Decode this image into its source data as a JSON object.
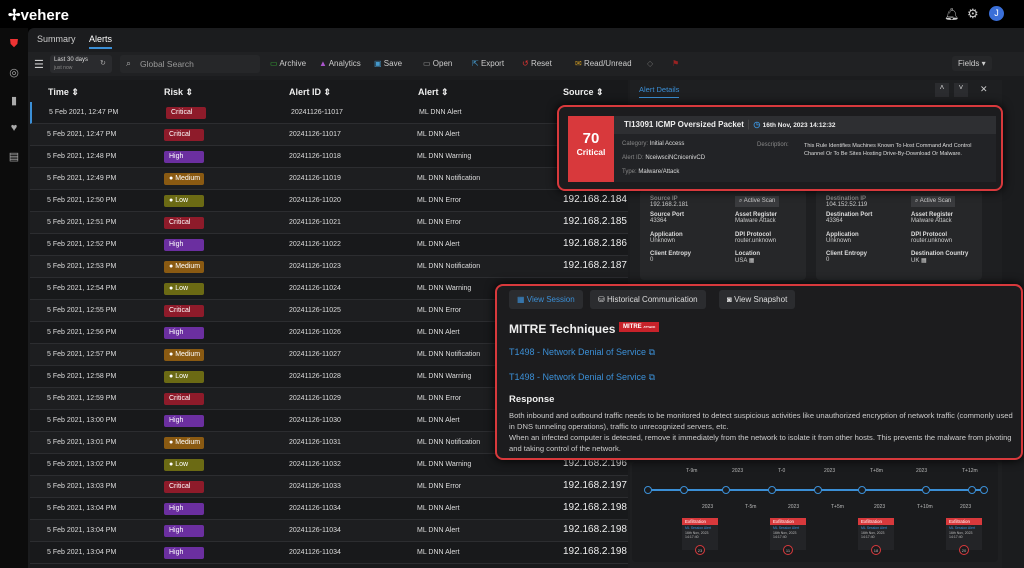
{
  "app": {
    "logo": "vehere"
  },
  "tabs": [
    "Summary",
    "Alerts"
  ],
  "toolbar": {
    "date_range": "Last 30 days",
    "date_sub": "just now",
    "search_placeholder": "Global Search",
    "archive": "Archive",
    "analytics": "Analytics",
    "save": "Save",
    "open": "Open",
    "export": "Export",
    "reset": "Reset",
    "read_unread": "Read/Unread",
    "fields": "Fields"
  },
  "table": {
    "headers": [
      "Time",
      "Risk",
      "Alert ID",
      "Alert",
      "Source"
    ],
    "rows": [
      [
        "5 Feb 2021, 12:47 PM",
        "Critical",
        "20241126-11017",
        "ML DNN Alert",
        ""
      ],
      [
        "5 Feb 2021, 12:47 PM",
        "Critical",
        "20241126-11017",
        "ML DNN Alert",
        ""
      ],
      [
        "5 Feb 2021, 12:48 PM",
        "High",
        "20241126-11018",
        "ML DNN Warning",
        ""
      ],
      [
        "5 Feb 2021, 12:49 PM",
        "Medium",
        "20241126-11019",
        "ML DNN Notification",
        ""
      ],
      [
        "5 Feb 2021, 12:50 PM",
        "Low",
        "20241126-11020",
        "ML DNN Error",
        "192.168.2.184"
      ],
      [
        "5 Feb 2021, 12:51 PM",
        "Critical",
        "20241126-11021",
        "ML DNN Error",
        "192.168.2.185"
      ],
      [
        "5 Feb 2021, 12:52 PM",
        "High",
        "20241126-11022",
        "ML DNN Alert",
        "192.168.2.186"
      ],
      [
        "5 Feb 2021, 12:53 PM",
        "Medium",
        "20241126-11023",
        "ML DNN Notification",
        "192.168.2.187"
      ],
      [
        "5 Feb 2021, 12:54 PM",
        "Low",
        "20241126-11024",
        "ML DNN Warning",
        ""
      ],
      [
        "5 Feb 2021, 12:55 PM",
        "Critical",
        "20241126-11025",
        "ML DNN Error",
        ""
      ],
      [
        "5 Feb 2021, 12:56 PM",
        "High",
        "20241126-11026",
        "ML DNN Alert",
        ""
      ],
      [
        "5 Feb 2021, 12:57 PM",
        "Medium",
        "20241126-11027",
        "ML DNN Notification",
        ""
      ],
      [
        "5 Feb 2021, 12:58 PM",
        "Low",
        "20241126-11028",
        "ML DNN Warning",
        ""
      ],
      [
        "5 Feb 2021, 12:59 PM",
        "Critical",
        "20241126-11029",
        "ML DNN Error",
        ""
      ],
      [
        "5 Feb 2021, 13:00 PM",
        "High",
        "20241126-11030",
        "ML DNN Alert",
        ""
      ],
      [
        "5 Feb 2021, 13:01 PM",
        "Medium",
        "20241126-11031",
        "ML DNN Notification",
        ""
      ],
      [
        "5 Feb 2021, 13:02 PM",
        "Low",
        "20241126-11032",
        "ML DNN Warning",
        "192.168.2.196"
      ],
      [
        "5 Feb 2021, 13:03 PM",
        "Critical",
        "20241126-11033",
        "ML DNN Error",
        "192.168.2.197"
      ],
      [
        "5 Feb 2021, 13:04 PM",
        "High",
        "20241126-11034",
        "ML DNN Alert",
        "192.168.2.198"
      ],
      [
        "5 Feb 2021, 13:04 PM",
        "High",
        "20241126-11034",
        "ML DNN Alert",
        "192.168.2.198"
      ],
      [
        "5 Feb 2021, 13:04 PM",
        "High",
        "20241126-11034",
        "ML DNN Alert",
        "192.168.2.198"
      ]
    ]
  },
  "risk_colors": {
    "Critical": "#8e1b2a",
    "High": "#6b2fa0",
    "Medium": "#8a5a12",
    "Low": "#6b6a14"
  },
  "panel": {
    "tab": "Alert Details"
  },
  "alert": {
    "score": "70",
    "severity": "Critical",
    "title": "TI13091 ICMP Oversized Packet",
    "timestamp": "16th Nov, 2023 14:12:32",
    "category_label": "Category:",
    "category": "Initial Access",
    "id_label": "Alert ID:",
    "id": "NceiwsciNCnicenivCD",
    "type_label": "Type:",
    "type": "Malware/Attack",
    "desc_label": "Description:",
    "description": "This Rule Identifies Machines Known To Host Command And Control Channel Or To Be Sites Hosting Drive-By-Download Or Malware."
  },
  "source": {
    "ip_label": "Source IP",
    "ip": "192.168.2.181",
    "scan": "Active Scan",
    "port_label": "Source Port",
    "port": "43364",
    "asset_label": "Asset Register",
    "asset": "Malware Attack",
    "app_label": "Application",
    "app": "Unknown",
    "dpi_label": "DPI Protocol",
    "dpi": "router.unknown",
    "entropy_label": "Client Entropy",
    "entropy": "0",
    "loc_label": "Location",
    "loc": "USA"
  },
  "dest": {
    "ip_label": "Destination IP",
    "ip": "104.152.52.119",
    "scan": "Active Scan",
    "port_label": "Destination Port",
    "port": "43364",
    "asset_label": "Asset Register",
    "asset": "Malware Attack",
    "app_label": "Application",
    "app": "Unknown",
    "dpi_label": "DPI Protocol",
    "dpi": "router.unknown",
    "entropy_label": "Client Entropy",
    "entropy": "0",
    "loc_label": "Destination Country",
    "loc": "UK"
  },
  "mitre": {
    "view_session": "View Session",
    "historical": "Historical Communication",
    "snapshot": "View Snapshot",
    "title": "MITRE Techniques",
    "badge": "MITRE",
    "badge_sub": "ATT&CK",
    "techniques": [
      "T1498 - Network Denial of Service",
      "T1498 - Network Denial of Service"
    ],
    "response_title": "Response",
    "response": [
      "Both inbound and outbound traffic needs to be monitored to detect suspicious activities like unauthorized encryption of network traffic (commonly used in DNS tunneling operations), traffic to unrecognized servers, etc.",
      "When an infected computer is detected, remove it immediately from the network to isolate it from other hosts. This prevents the malware from pivoting and taking control of the network."
    ]
  },
  "timeline": {
    "top_labels": [
      "T-9m",
      "2023",
      "T-0",
      "2023",
      "T+8m",
      "2023",
      "T+12m"
    ],
    "bottom_labels": [
      "2023",
      "T-5m",
      "2023",
      "T+5m",
      "2023",
      "T+10m",
      "2023"
    ],
    "cards": [
      {
        "title": "Exfiltration",
        "sub": "ML Session Alert",
        "date": "16th Nov, 2023",
        "time": "14:17:40",
        "count": "23"
      },
      {
        "title": "Exfiltration",
        "sub": "ML Session Alert",
        "date": "16th Nov, 2023",
        "time": "14:17:40",
        "count": "11"
      },
      {
        "title": "Exfiltration",
        "sub": "ML Session Alert",
        "date": "16th Nov, 2023",
        "time": "14:17:40",
        "count": "18"
      },
      {
        "title": "Exfiltration",
        "sub": "ML Session Alert",
        "date": "16th Nov, 2023",
        "time": "14:17:40",
        "count": "20"
      }
    ]
  }
}
